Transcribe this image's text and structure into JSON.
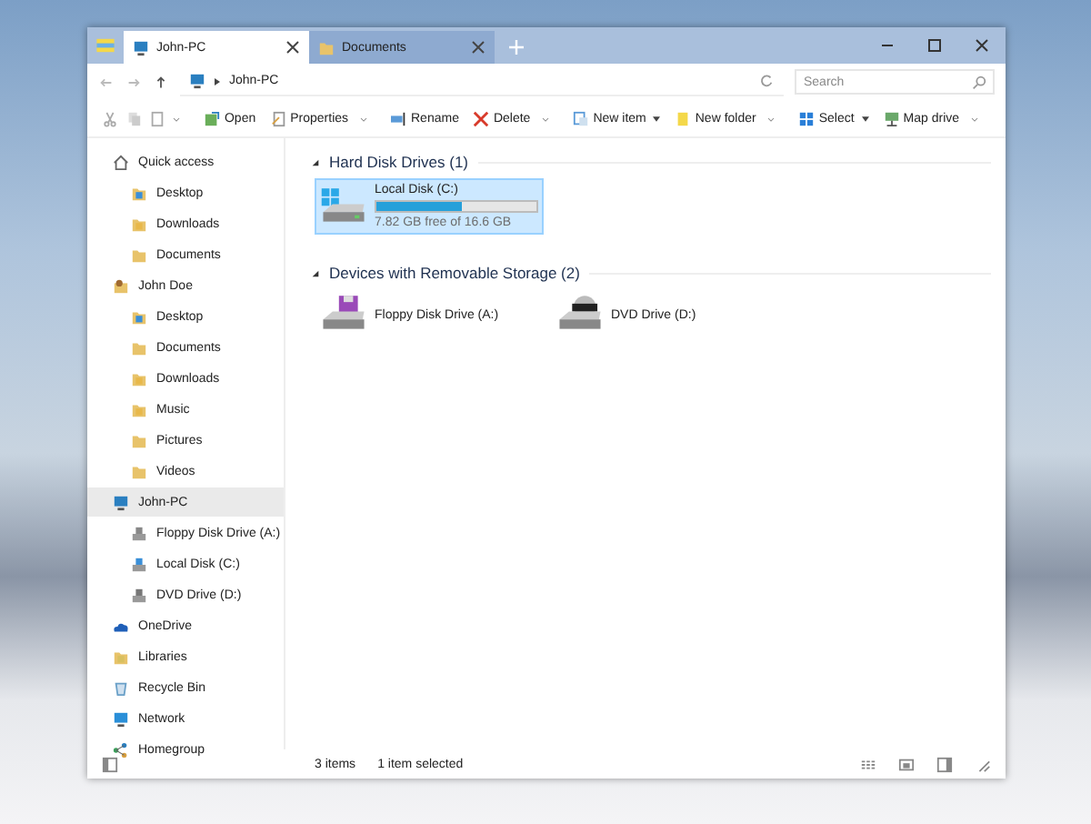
{
  "tabs": [
    {
      "label": "John-PC",
      "selected": true,
      "kind": "computer"
    },
    {
      "label": "Documents",
      "selected": false,
      "kind": "documents"
    }
  ],
  "address": {
    "path": "John-PC",
    "search": {
      "placeholder": "Search"
    }
  },
  "toolbar": [
    {
      "kind": "cut"
    },
    {
      "kind": "copy"
    },
    {
      "kind": "paste"
    },
    {
      "kind": "more"
    },
    {
      "kind": "open",
      "label": "Open"
    },
    {
      "kind": "properties",
      "label": "Properties"
    },
    {
      "kind": "more"
    },
    {
      "kind": "rename",
      "label": "Rename"
    },
    {
      "kind": "delete",
      "label": "Delete"
    },
    {
      "kind": "more"
    },
    {
      "kind": "new-item",
      "label": "New item",
      "dropdown": true
    },
    {
      "kind": "new-folder",
      "label": "New folder"
    },
    {
      "kind": "more"
    },
    {
      "kind": "select",
      "label": "Select",
      "dropdown": true
    },
    {
      "kind": "map-drive",
      "label": "Map drive"
    },
    {
      "kind": "more"
    }
  ],
  "sidebar": {
    "items": [
      {
        "label": "Quick access",
        "kind": "star",
        "selected": false,
        "children": [
          {
            "label": "Desktop",
            "kind": "desktop",
            "selected": false
          },
          {
            "label": "Downloads",
            "kind": "downloads",
            "selected": false
          },
          {
            "label": "Documents",
            "kind": "documents",
            "selected": false
          }
        ]
      },
      {
        "label": "John Doe",
        "kind": "user",
        "selected": false,
        "children": [
          {
            "label": "Desktop",
            "kind": "desktop",
            "selected": false
          },
          {
            "label": "Documents",
            "kind": "documents",
            "selected": false
          },
          {
            "label": "Downloads",
            "kind": "downloads",
            "selected": false
          },
          {
            "label": "Music",
            "kind": "music",
            "selected": false
          },
          {
            "label": "Pictures",
            "kind": "pictures",
            "selected": false
          },
          {
            "label": "Videos",
            "kind": "videos",
            "selected": false
          }
        ]
      },
      {
        "label": "John-PC",
        "kind": "computer",
        "selected": true,
        "children": [
          {
            "label": "Floppy Disk Drive (A:)",
            "kind": "floppy",
            "selected": false
          },
          {
            "label": "Local Disk (C:)",
            "kind": "disk",
            "selected": false
          },
          {
            "label": "DVD Drive (D:)",
            "kind": "dvd",
            "selected": false
          }
        ]
      },
      {
        "label": "OneDrive",
        "kind": "cloud",
        "selected": false
      },
      {
        "label": "Libraries",
        "kind": "libraries",
        "selected": false
      },
      {
        "label": "Recycle Bin",
        "kind": "recycle",
        "selected": false
      },
      {
        "label": "Network",
        "kind": "network",
        "selected": false
      },
      {
        "label": "Homegroup",
        "kind": "homegroup",
        "selected": false
      }
    ]
  },
  "groups": [
    {
      "title": "Hard Disk Drives (1)",
      "items": [
        {
          "name": "Local Disk (C:)",
          "kind": "disk",
          "selected": true,
          "level": 0.53,
          "free": "7.82 GB free of 16.6 GB"
        }
      ]
    },
    {
      "title": "Devices with Removable Storage (2)",
      "items": [
        {
          "name": "Floppy Disk Drive (A:)",
          "kind": "floppy",
          "selected": false
        },
        {
          "name": "DVD Drive (D:)",
          "kind": "dvd",
          "selected": false
        }
      ]
    }
  ],
  "status_bar": {
    "count": "3 items",
    "selection": "1 item selected"
  }
}
